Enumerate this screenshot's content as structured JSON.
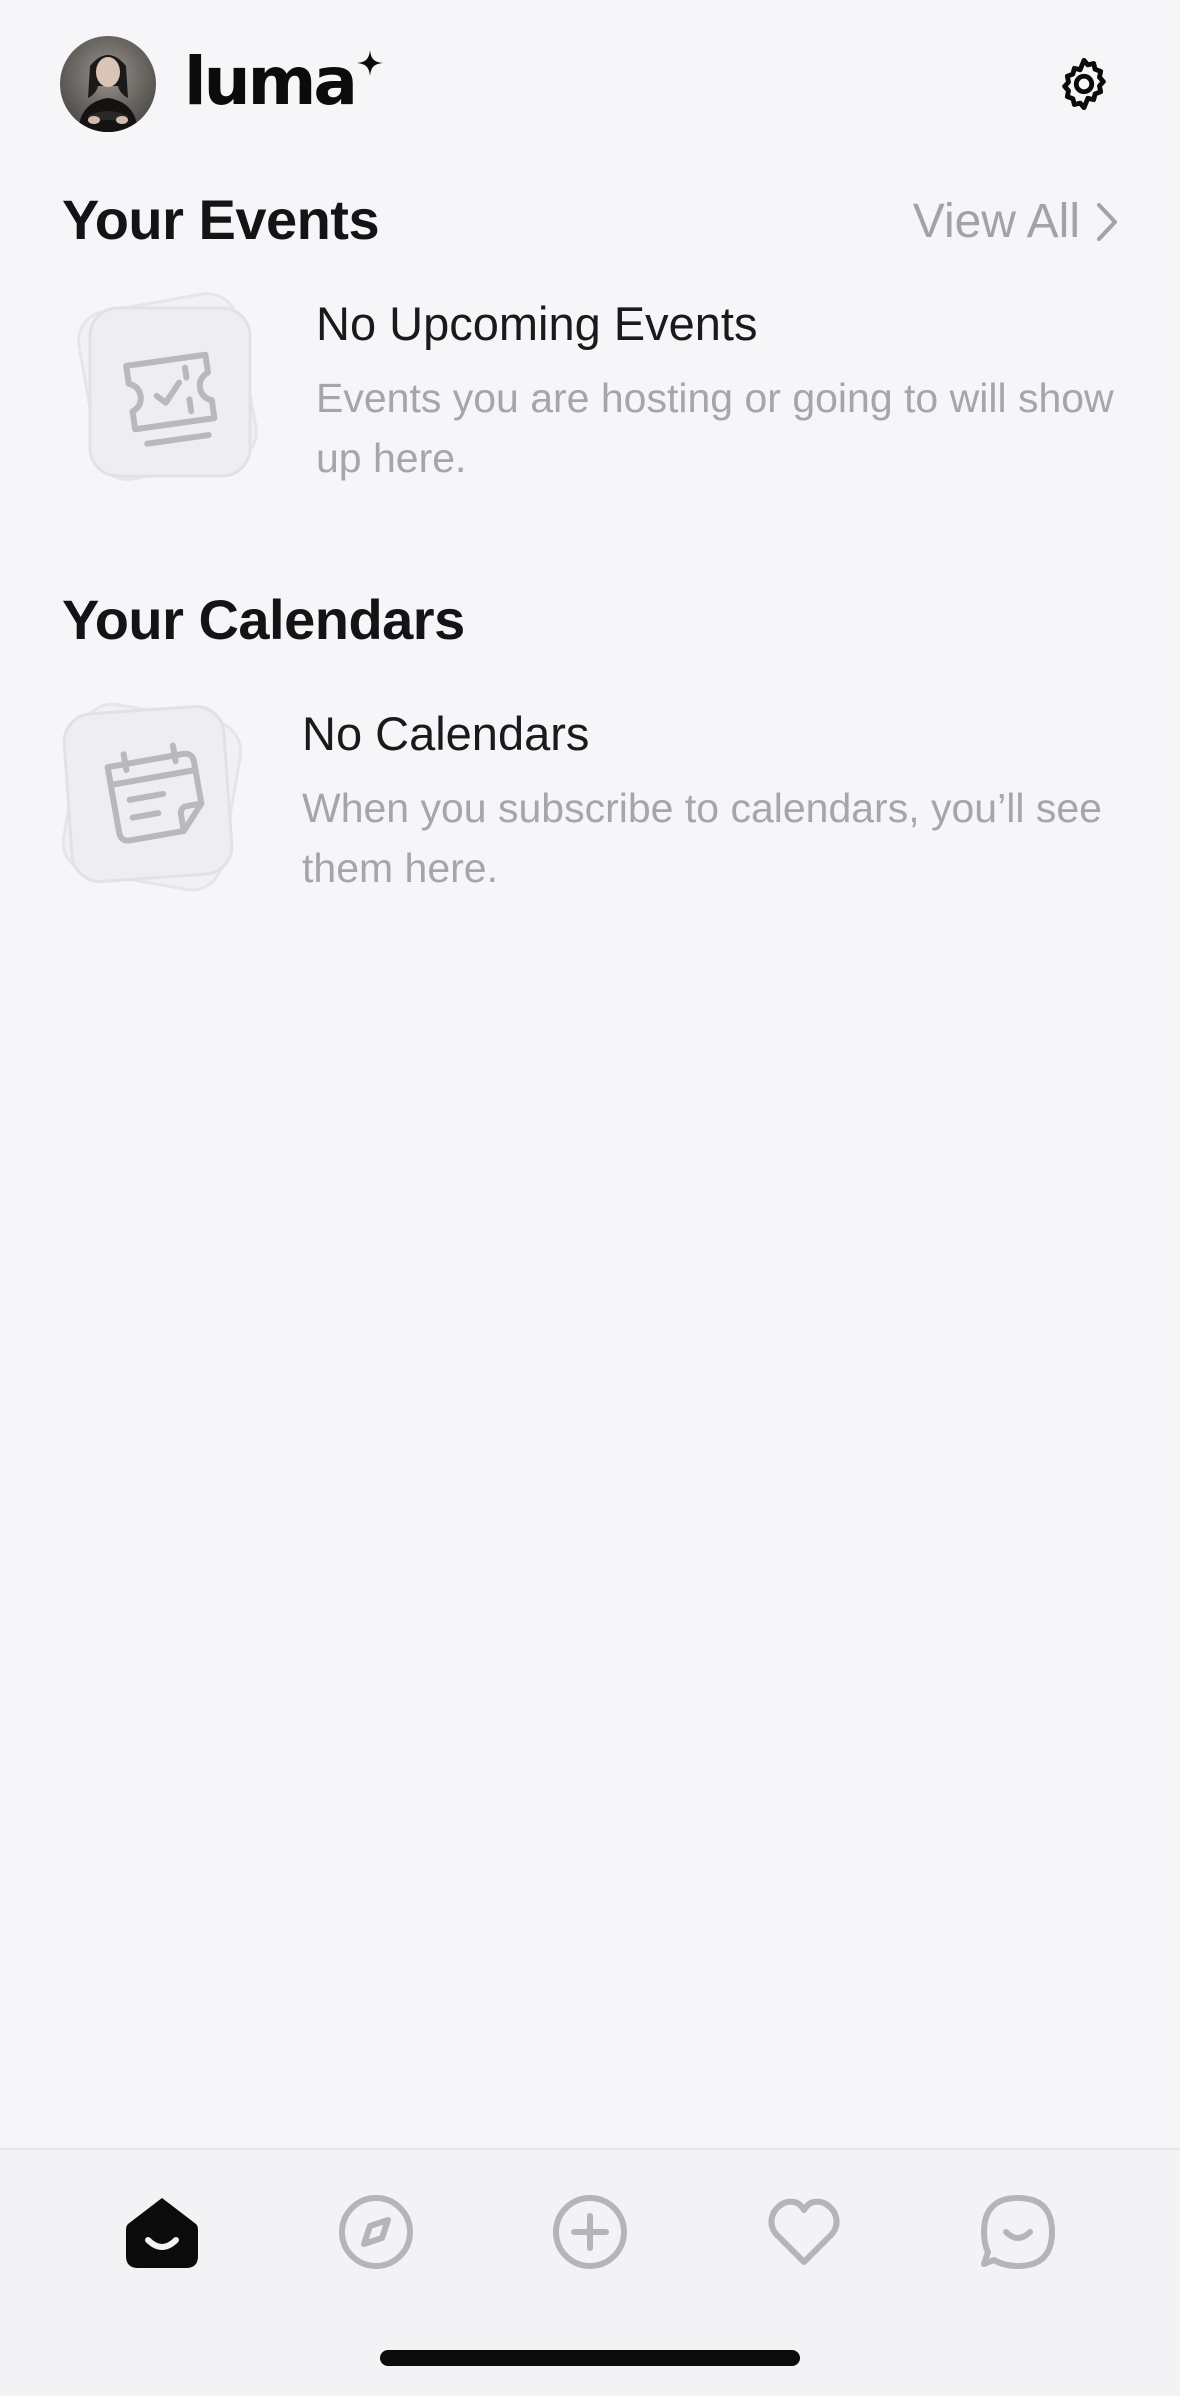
{
  "app": {
    "logo_text": "luma"
  },
  "header": {
    "avatar_icon": "user-avatar",
    "settings_icon": "gear-icon"
  },
  "events": {
    "title": "Your Events",
    "view_all_label": "View All",
    "empty_title": "No Upcoming Events",
    "empty_description": "Events you are hosting or going to will show up here.",
    "empty_icon": "ticket-icon"
  },
  "calendars": {
    "title": "Your Calendars",
    "empty_title": "No Calendars",
    "empty_description": "When you subscribe to calendars, you’ll see them here.",
    "empty_icon": "calendar-icon"
  },
  "tabbar": {
    "tabs": [
      {
        "name": "home",
        "icon": "home-icon",
        "active": true
      },
      {
        "name": "explore",
        "icon": "compass-icon",
        "active": false
      },
      {
        "name": "create",
        "icon": "plus-circle-icon",
        "active": false
      },
      {
        "name": "likes",
        "icon": "heart-icon",
        "active": false
      },
      {
        "name": "chat",
        "icon": "chat-icon",
        "active": false
      }
    ]
  },
  "colors": {
    "background": "#f6f6f8",
    "primary_text": "#141416",
    "secondary_text": "#a5a5ab",
    "active_tab": "#0b0b0c",
    "inactive_tab": "#b4b4ba"
  }
}
